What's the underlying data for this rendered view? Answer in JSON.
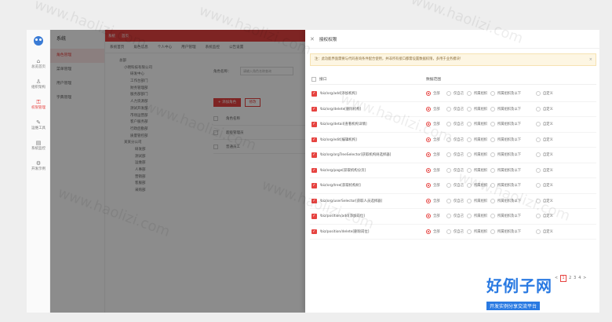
{
  "rail": {
    "items": [
      {
        "icon": "home-icon",
        "label": "总览首页"
      },
      {
        "icon": "user-icon",
        "label": "组织架构"
      },
      {
        "icon": "lock-icon",
        "label": "权限管理"
      },
      {
        "icon": "tool-icon",
        "label": "运维工具"
      },
      {
        "icon": "doc-icon",
        "label": "系统监控"
      },
      {
        "icon": "gear-icon",
        "label": "开发示例"
      }
    ],
    "active_index": 2
  },
  "menu": {
    "title": "系统",
    "items": [
      "角色管理",
      "菜单管理",
      "用户管理",
      "字典管理"
    ]
  },
  "topbar": {
    "buttons": [
      "系统",
      "首页"
    ]
  },
  "tabs": [
    "系统首页",
    "角色信息",
    "个人中心",
    "用户管理",
    "系统监控",
    "公告设置"
  ],
  "tree": {
    "nodes": [
      "总部",
      "小明科技有限公司",
      "研发中心",
      "工作台部门",
      "财务管理部",
      "服务部部门",
      "人力资源部",
      "测试开发部",
      "市场运营部",
      "客户服务部",
      "行政后勤部",
      "质量管控部",
      "某某分公司",
      "研发部",
      "测试部",
      "运维部",
      "人事部",
      "营销部",
      "客服部",
      "采购部"
    ]
  },
  "rolepanel": {
    "search_label": "角色名称：",
    "search_placeholder": "请输入角色名称查询",
    "add_label": "+ 添加角色",
    "edit_label": "修改",
    "rows": [
      "角色名称",
      "超级管理员",
      "普通员工"
    ]
  },
  "drawer": {
    "title": "授权权限",
    "notice": "注：此功能界面需要与代码查询条件配合使用，并非所有接口都需设置数据权限，多用于业务模块！",
    "header_api": "接口",
    "header_scope": "数据范围",
    "scope_options": [
      "全部",
      "仅自己",
      "所属组织",
      "所属组织及以下",
      "自定义"
    ],
    "rows": [
      {
        "url": "/biz/org/add[添加机构]",
        "selected": 0
      },
      {
        "url": "/biz/org/delete[删除机构]",
        "selected": 0
      },
      {
        "url": "/biz/org/detail[查看机构详情]",
        "selected": 0
      },
      {
        "url": "/biz/org/edit[编辑机构]",
        "selected": 0
      },
      {
        "url": "/biz/org/orgTreeSelector[获取机构树选择器]",
        "selected": 0
      },
      {
        "url": "/biz/org/page[获取机构分页]",
        "selected": 0
      },
      {
        "url": "/biz/org/tree[获取机构树]",
        "selected": 0
      },
      {
        "url": "/biz/org/userSelector[获取人员选择器]",
        "selected": 0
      },
      {
        "url": "/biz/position/add[添加岗位]",
        "selected": 0
      },
      {
        "url": "/biz/position/delete[删除岗位]",
        "selected": 0
      }
    ],
    "pager": {
      "pages": [
        "<",
        "1",
        "2",
        "3",
        "4",
        ">"
      ],
      "current": "1"
    }
  },
  "brand": {
    "title": "好例子网",
    "subtitle": "开发实例分享交流平台"
  },
  "watermark": "www.haolizi.com"
}
